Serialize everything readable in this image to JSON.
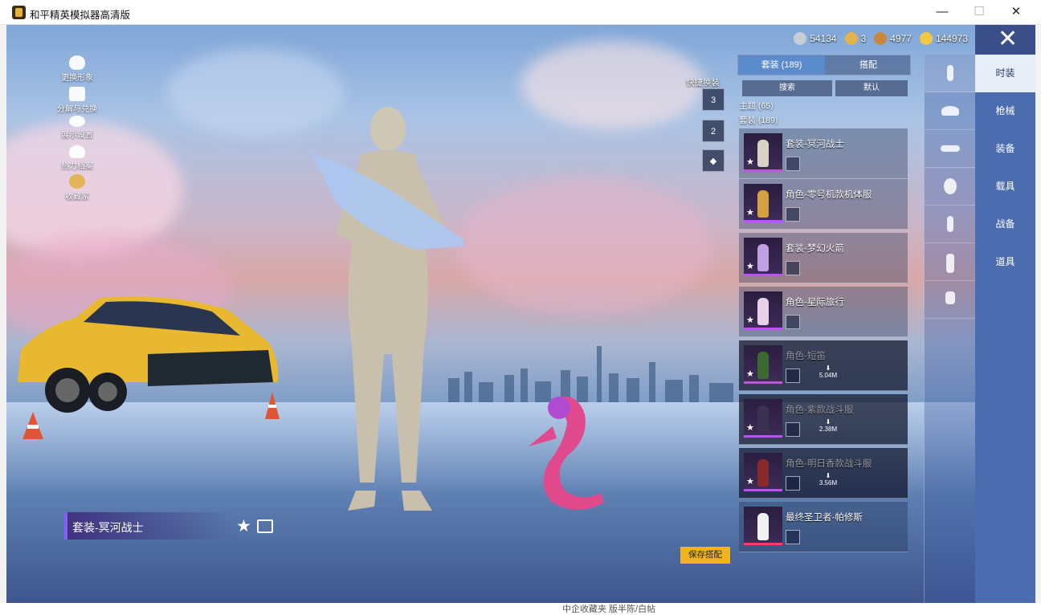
{
  "window": {
    "title": "和平精英模拟器高清版",
    "minimize_label": "—",
    "maximize_label": "☐",
    "close_label": "✕"
  },
  "currency": [
    {
      "icon": "silver-coin-icon",
      "value": "54134"
    },
    {
      "icon": "gold-badge-icon",
      "value": "3"
    },
    {
      "icon": "bronze-coin-icon",
      "value": "4977"
    },
    {
      "icon": "gold-coin-icon",
      "value": "144973"
    }
  ],
  "left_menu": [
    {
      "label": "更换形象",
      "icon": "person-icon"
    },
    {
      "label": "分解与兑换",
      "icon": "puzzle-icon"
    },
    {
      "label": "展示设置",
      "icon": "eye-icon"
    },
    {
      "label": "热力档案",
      "icon": "flame-icon"
    },
    {
      "label": "收藏家",
      "icon": "medal-icon"
    }
  ],
  "quick_change": {
    "label": "快捷换装",
    "slots": [
      "3",
      "2",
      ""
    ]
  },
  "panel": {
    "tabs": [
      "套装 (189)",
      "搭配"
    ],
    "search_label": "搜索",
    "sort_label": "默认",
    "theme_group": "主题 (65)",
    "outfit_group": "套装 (189)"
  },
  "items": [
    {
      "name": "套装-冥河战士",
      "download": ""
    },
    {
      "name": "角色-零号机款机体服",
      "download": ""
    },
    {
      "name": "套装-梦幻火箭",
      "download": ""
    },
    {
      "name": "角色-星际旅行",
      "download": ""
    },
    {
      "name": "角色-短笛",
      "download": "5.04M"
    },
    {
      "name": "角色-紫款战斗服",
      "download": "2.38M"
    },
    {
      "name": "角色-明日香款战斗服",
      "download": "3.56M"
    },
    {
      "name": "最终圣卫者-帕修斯",
      "download": ""
    }
  ],
  "categories": [
    "时装",
    "枪械",
    "装备",
    "载具",
    "战备",
    "道具"
  ],
  "current_outfit": "套装-冥河战士",
  "save_label": "保存搭配",
  "background_text": "中企收藏夹   版半陈/白帖"
}
